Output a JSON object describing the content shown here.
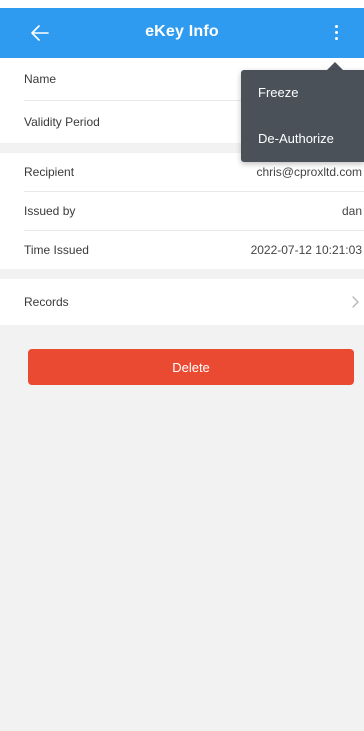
{
  "header": {
    "title": "eKey Info",
    "back_icon": "arrow-left-icon",
    "more_icon": "more-vertical-icon",
    "background": "#2f9bf0"
  },
  "key_info": {
    "name_label": "Name",
    "validity_label": "Validity Period"
  },
  "details": {
    "recipient_label": "Recipient",
    "recipient_value": "chris@cproxltd.com",
    "issued_by_label": "Issued by",
    "issued_by_value": "dan",
    "time_issued_label": "Time Issued",
    "time_issued_value": "2022-07-12 10:21:03"
  },
  "records": {
    "label": "Records",
    "chevron_icon": "chevron-right-icon"
  },
  "actions": {
    "delete_label": "Delete",
    "delete_color": "#ea4a31"
  },
  "menu": {
    "freeze_label": "Freeze",
    "deauthorize_label": "De-Authorize",
    "background": "#4b5159"
  }
}
